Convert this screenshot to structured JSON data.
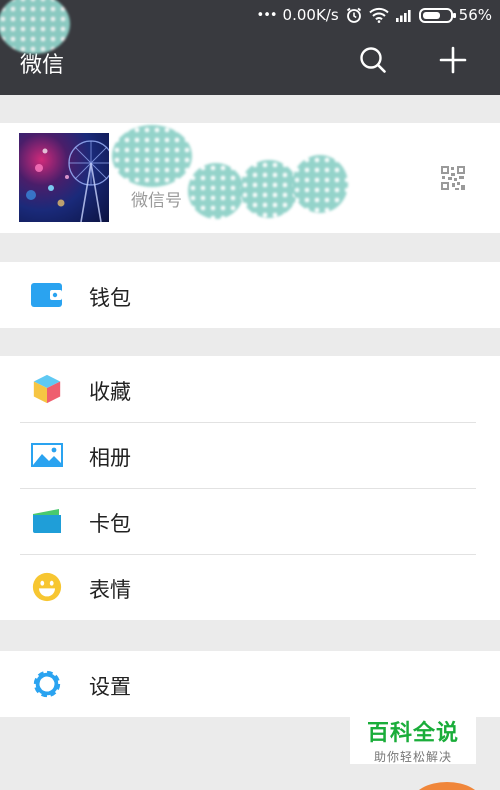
{
  "status_bar": {
    "dots": "•••",
    "network_speed": "0.00K/s",
    "battery_percent": "56%",
    "icons": [
      "alarm-icon",
      "wifi-icon",
      "signal-icon",
      "battery-icon"
    ]
  },
  "header": {
    "title": "微信",
    "search_icon": "search-icon",
    "add_icon": "plus-icon"
  },
  "profile": {
    "wechat_id_label": "微信号",
    "qr_icon": "qr-code-icon"
  },
  "menu_groups": [
    {
      "items": [
        {
          "label": "钱包",
          "icon": "wallet-icon"
        }
      ]
    },
    {
      "items": [
        {
          "label": "收藏",
          "icon": "favorites-cube-icon"
        },
        {
          "label": "相册",
          "icon": "album-icon"
        },
        {
          "label": "卡包",
          "icon": "card-wallet-icon"
        },
        {
          "label": "表情",
          "icon": "emoji-icon"
        }
      ]
    },
    {
      "items": [
        {
          "label": "设置",
          "icon": "settings-gear-icon"
        }
      ]
    }
  ],
  "watermark": {
    "main": "百科全说",
    "sub": "助你轻松解决"
  },
  "colors": {
    "topbar": "#393a3f",
    "background": "#ebebeb",
    "accent_blue": "#2aa3f0",
    "accent_green": "#1aad3a"
  }
}
